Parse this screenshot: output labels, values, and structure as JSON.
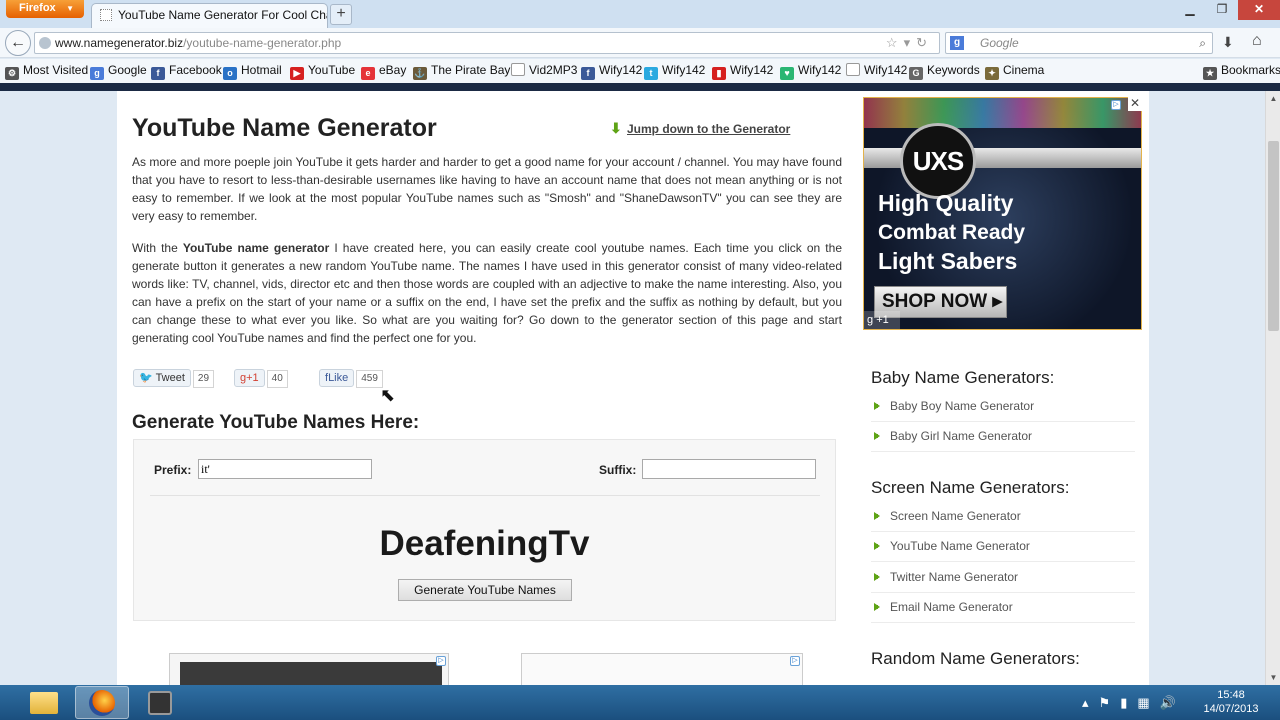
{
  "browser": {
    "menu_label": "Firefox",
    "tab_title": "YouTube Name Generator For Cool Cha...",
    "new_tab": "+",
    "url_domain": "www.namegenerator.biz",
    "url_path": "/youtube-name-generator.php",
    "search_placeholder": "Google",
    "bookmarks": [
      {
        "label": "Most Visited",
        "icon": "gear-icon",
        "color": "#555555"
      },
      {
        "label": "Google",
        "icon": "google-icon",
        "color": "#4a7bd9"
      },
      {
        "label": "Facebook",
        "icon": "facebook-icon",
        "color": "#3b5998"
      },
      {
        "label": "Hotmail",
        "icon": "outlook-icon",
        "color": "#2a72c6"
      },
      {
        "label": "YouTube",
        "icon": "youtube-icon",
        "color": "#d6201f"
      },
      {
        "label": "eBay",
        "icon": "ebay-icon",
        "color": "#e53238"
      },
      {
        "label": "The Pirate Bay",
        "icon": "pirate-ship-icon",
        "color": "#6b5a3a"
      },
      {
        "label": "Vid2MP3",
        "icon": "blank-page-icon",
        "color": "#ffffff"
      },
      {
        "label": "Wify142",
        "icon": "facebook-icon",
        "color": "#3b5998"
      },
      {
        "label": "Wify142",
        "icon": "twitter-icon",
        "color": "#2aa9e0"
      },
      {
        "label": "Wify142",
        "icon": "bar-chart-icon",
        "color": "#d6201f"
      },
      {
        "label": "Wify142",
        "icon": "heart-icon",
        "color": "#2bb673"
      },
      {
        "label": "Wify142",
        "icon": "blank-page-icon",
        "color": "#ffffff"
      },
      {
        "label": "Keywords",
        "icon": "google-g-icon",
        "color": "#666666"
      },
      {
        "label": "Cinema",
        "icon": "cinema-icon",
        "color": "#7a6a3a"
      }
    ],
    "bookmarks_menu": "Bookmarks"
  },
  "page": {
    "title": "YouTube Name Generator",
    "jump_link": "Jump down to the Generator",
    "intro": "As more and more poeple join YouTube it gets harder and harder to get a good name for your account / channel. You may have found that you have to resort to less-than-desirable usernames like having to have an account name that does not mean anything or is not easy to remember. If we look at the most popular YouTube names such as \"Smosh\" and \"ShaneDawsonTV\" you can see they are very easy to remember.",
    "body_prefix": "With the ",
    "body_bold": "YouTube name generator",
    "body_rest": " I have created here, you can easily create cool youtube names. Each time you click on the generate button it generates a new random YouTube name. The names I have used in this generator consist of many video-related words like: TV, channel, vids, director etc and then those words are coupled with an adjective to make the name interesting. Also, you can have a prefix on the start of your name or a suffix on the end, I have set the prefix and the suffix as nothing by default, but you can change these to what ever you like. So what are you waiting for? Go down to the generator section of this page and start generating cool YouTube names and find the perfect one for you.",
    "share": {
      "tweet_label": "Tweet",
      "tweet_count": "29",
      "gplus_label": "+1",
      "gplus_count": "40",
      "like_label": "Like",
      "like_count": "459"
    },
    "generator": {
      "heading": "Generate YouTube Names Here:",
      "prefix_label": "Prefix:",
      "prefix_value": "it'",
      "suffix_label": "Suffix:",
      "suffix_value": "",
      "result": "DeafeningTv",
      "button_label": "Generate YouTube Names"
    }
  },
  "ad": {
    "logo": "UXS",
    "line1": "High Quality",
    "line2": "Combat Ready",
    "line3": "Light Sabers",
    "cta": "SHOP NOW ▸",
    "gplus": "+1"
  },
  "sidebar": {
    "sections": [
      {
        "heading": "Baby Name Generators:",
        "links": [
          "Baby Boy Name Generator",
          "Baby Girl Name Generator"
        ]
      },
      {
        "heading": "Screen Name Generators:",
        "links": [
          "Screen Name Generator",
          "YouTube Name Generator",
          "Twitter Name Generator",
          "Email Name Generator"
        ]
      },
      {
        "heading": "Random Name Generators:",
        "links": []
      }
    ]
  },
  "taskbar": {
    "time": "15:48",
    "date": "14/07/2013"
  }
}
